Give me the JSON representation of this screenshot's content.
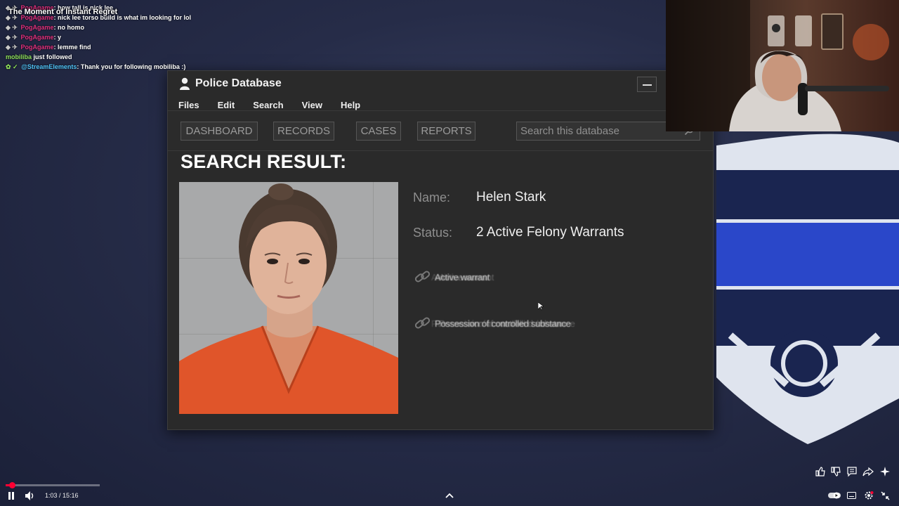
{
  "video": {
    "title": "The Moment of Instant Regret"
  },
  "chat": [
    {
      "user": "PogAgame",
      "color": "#e0307c",
      "message": ": how tall is nick lee"
    },
    {
      "user": "PogAgame",
      "color": "#e0307c",
      "message": ": nick lee torso build is what im looking for lol"
    },
    {
      "user": "PogAgame",
      "color": "#e0307c",
      "message": ": no homo"
    },
    {
      "user": "PogAgame",
      "color": "#e0307c",
      "message": ": y"
    },
    {
      "user": "PogAgame",
      "color": "#e0307c",
      "message": ": lemme find"
    }
  ],
  "chat_events": {
    "follow_user": "mobiliba",
    "follow_text": " just followed",
    "bot_user": "@StreamElements",
    "bot_message": ": Thank you for following mobiliba :)"
  },
  "window": {
    "title": "Police Database",
    "menu": [
      "Files",
      "Edit",
      "Search",
      "View",
      "Help"
    ],
    "nav": [
      "DASHBOARD",
      "RECORDS",
      "CASES",
      "REPORTS"
    ],
    "search_placeholder": "Search this database"
  },
  "result": {
    "heading": "SEARCH RESULT:",
    "name_label": "Name:",
    "name_value": "Helen Stark",
    "status_label": "Status:",
    "status_value": "2 Active Felony Warrants",
    "links": [
      "Active warrant",
      "Possession of controlled substance"
    ]
  },
  "player": {
    "time": "1:03 / 15:16",
    "progress_fraction": 0.069
  },
  "colors": {
    "accent": "#ff0033",
    "chat_user": "#e0307c",
    "follow_user": "#8ee05a",
    "bot_user": "#4fc3f7"
  },
  "icons": [
    "user-icon",
    "search-icon",
    "link-icon",
    "play-pause-icon",
    "volume-icon",
    "like-icon",
    "dislike-icon",
    "comment-icon",
    "share-icon",
    "sparkle-icon",
    "autoplay-toggle-icon",
    "captions-icon",
    "settings-icon",
    "fullscreen-exit-icon",
    "chevron-up-icon"
  ]
}
